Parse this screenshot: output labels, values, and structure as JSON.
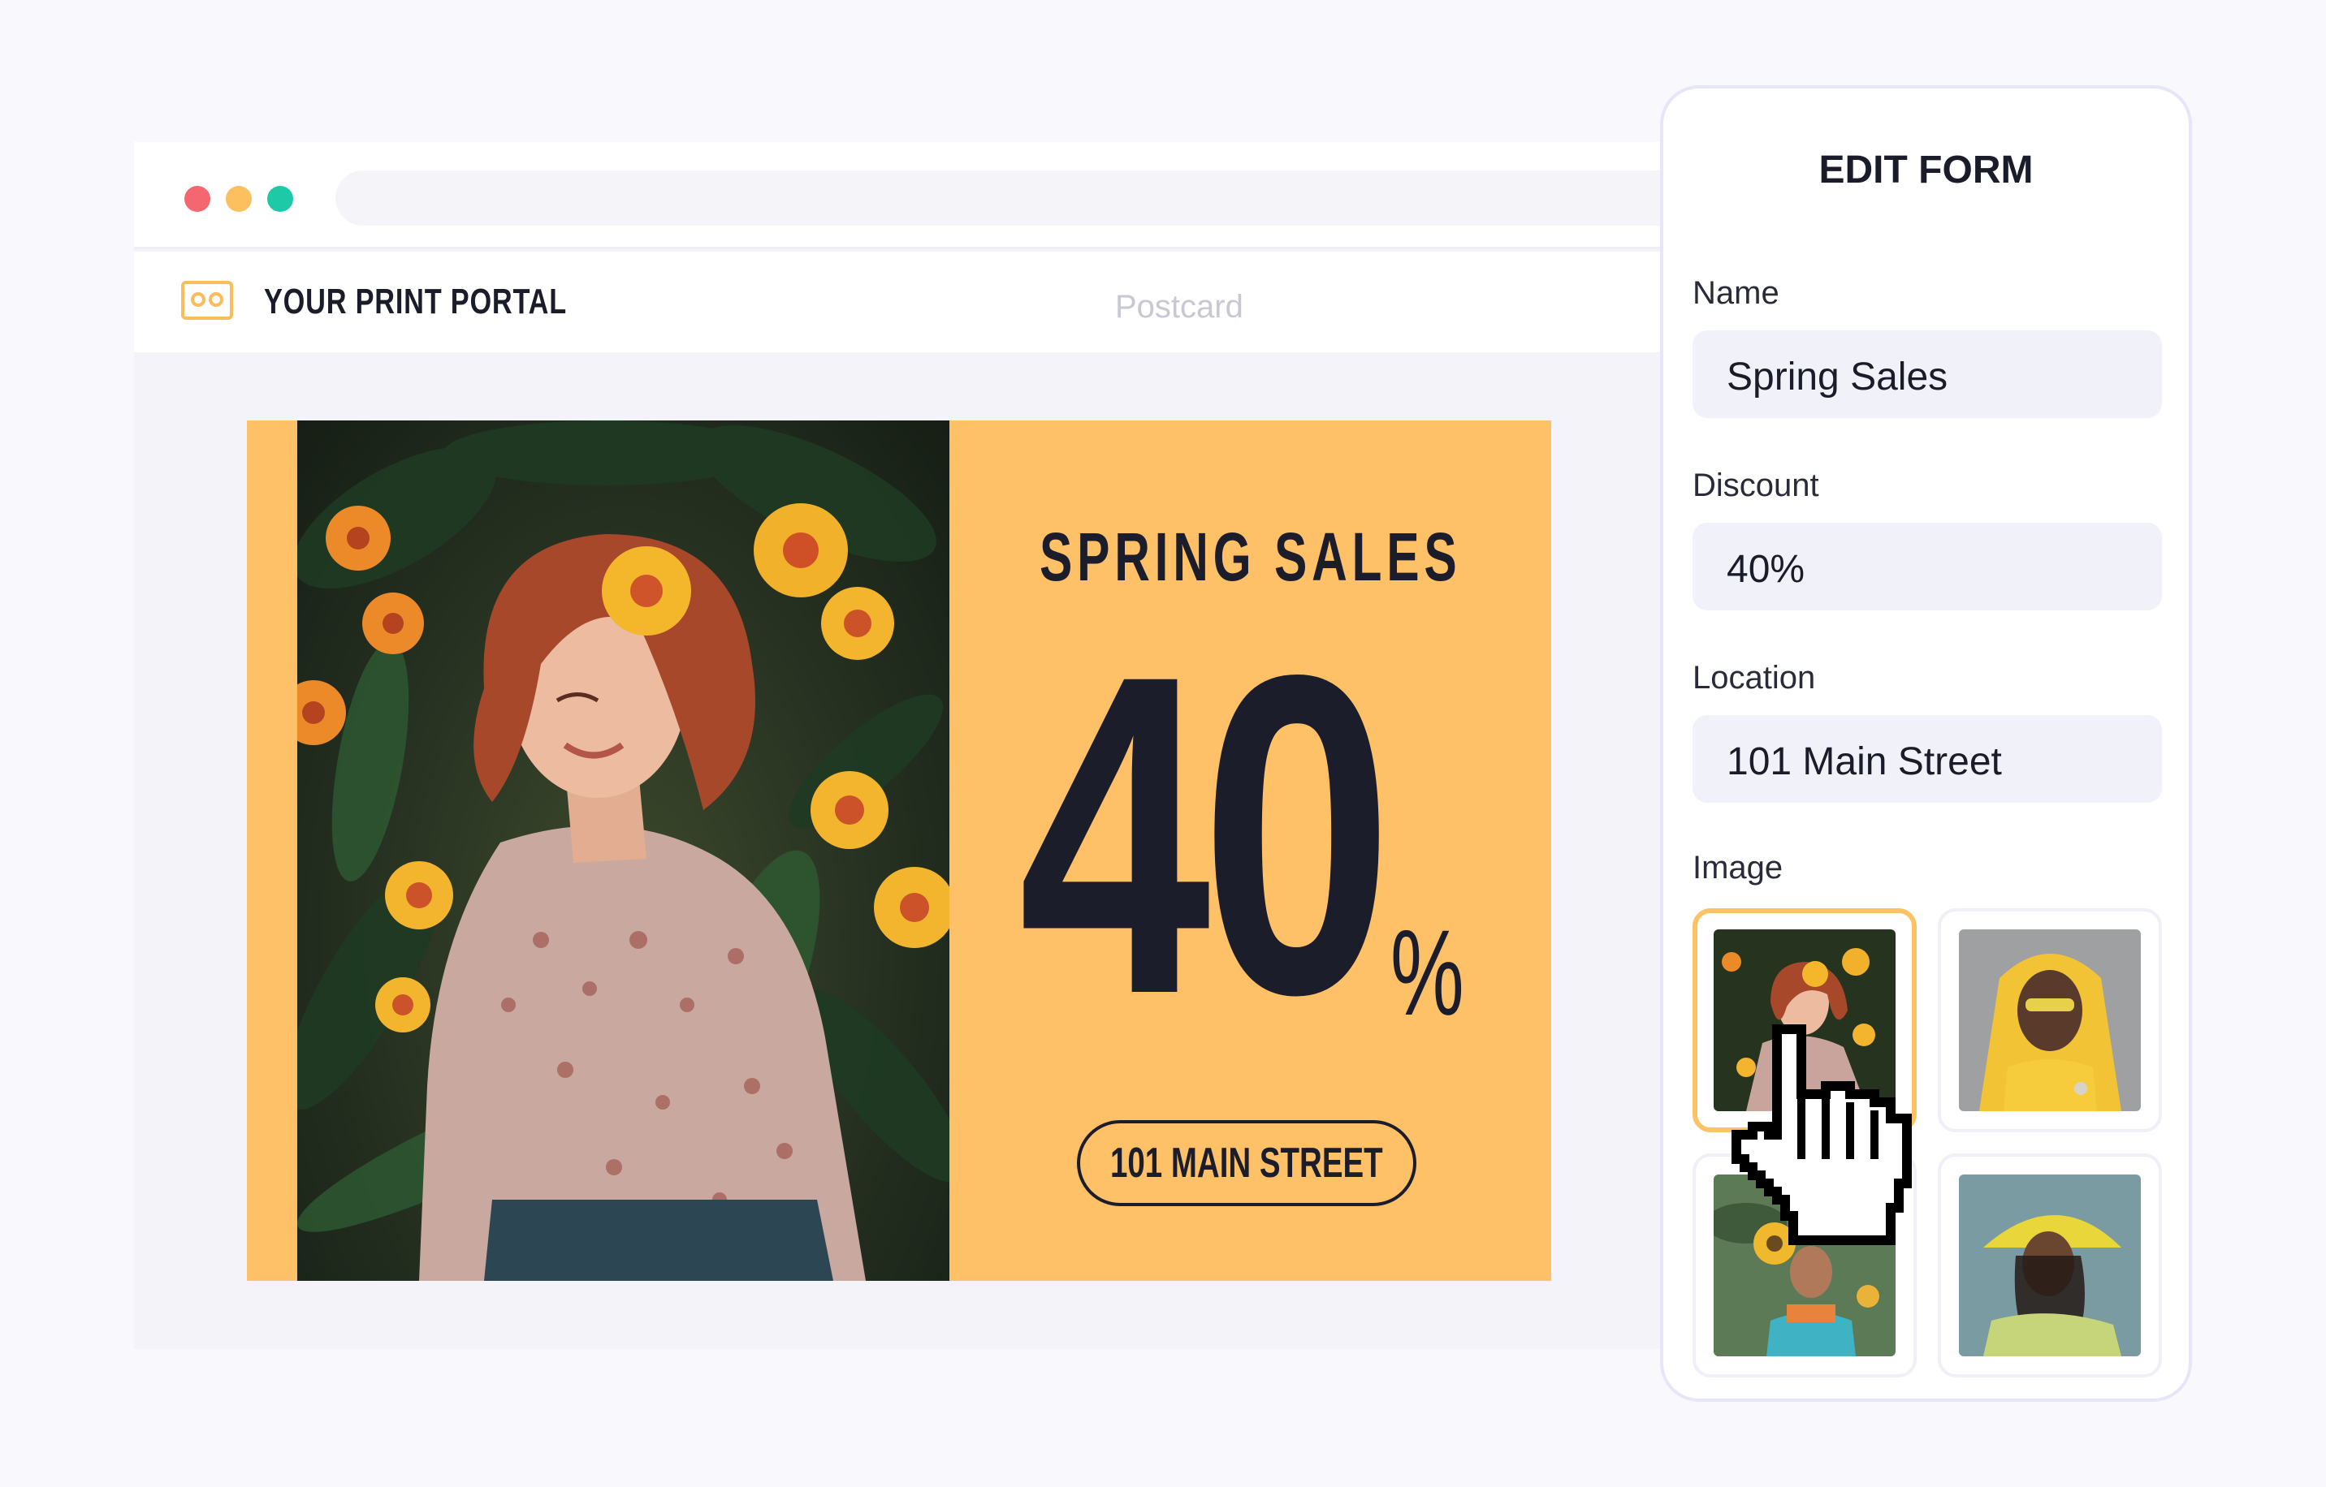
{
  "browser": {
    "nav": {
      "brand": "YOUR PRINT PORTAL",
      "document_title": "Postcard"
    }
  },
  "postcard": {
    "title": "SPRING SALES",
    "discount_number": "40",
    "discount_symbol": "%",
    "address": "101 MAIN STREET",
    "background_color": "#fec167"
  },
  "edit_form": {
    "title": "EDIT FORM",
    "fields": {
      "name": {
        "label": "Name",
        "value": "Spring Sales"
      },
      "discount": {
        "label": "Discount",
        "value": "40%"
      },
      "location": {
        "label": "Location",
        "value": "101 Main Street"
      }
    },
    "image_label": "Image",
    "selected_image_index": 0
  },
  "colors": {
    "accent": "#fcc266",
    "dark": "#1c1d2a"
  },
  "icons": [
    "window-close-dot",
    "window-minimize-dot",
    "window-maximize-dot",
    "print-portal-logo-icon",
    "pointer-hand-cursor-icon"
  ]
}
